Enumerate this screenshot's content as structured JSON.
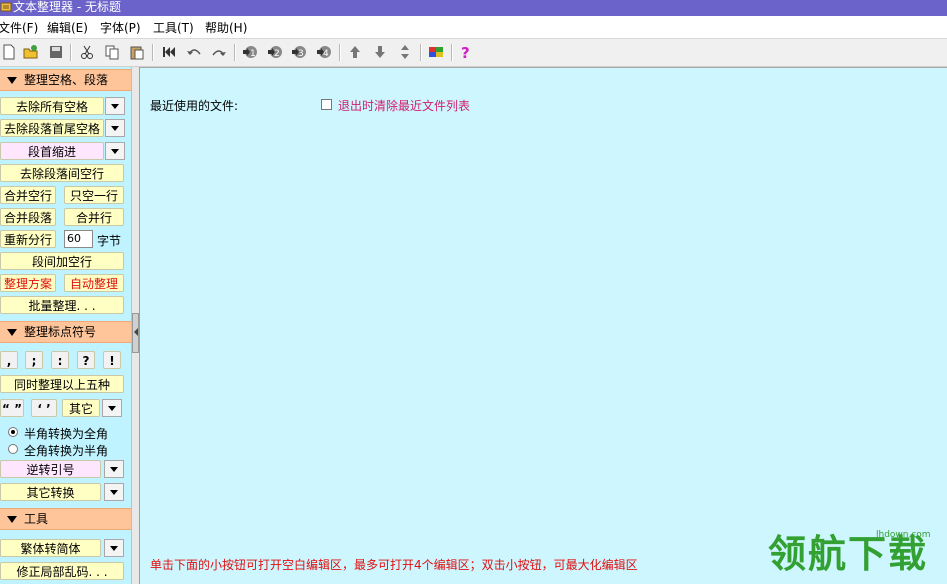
{
  "window": {
    "title": "文本整理器 - 无标题"
  },
  "menu": [
    "文件(F)",
    "编辑(E)",
    "字体(P)",
    "工具(T)",
    "帮助(H)"
  ],
  "colors": {
    "accent_title": "#6b63c9",
    "panel_bg": "#bff3ff",
    "main_bg": "#cef6ff",
    "section_bg": "#ffc59a",
    "hint_red": "#e01010",
    "watermark_green": "#33a032"
  },
  "toolbar_icons": [
    "new-file-icon",
    "open-file-icon",
    "save-icon",
    "cut-icon",
    "copy-icon",
    "paste-icon",
    "first-icon",
    "undo-icon",
    "redo-icon",
    "editor1-icon",
    "editor2-icon",
    "editor3-icon",
    "editor4-icon",
    "up-icon",
    "down-icon",
    "updown-icon",
    "palette-icon",
    "help-icon"
  ],
  "sections": {
    "s1": "整理空格、段落",
    "s2": "整理标点符号",
    "s3": "工具"
  },
  "buttons": {
    "remove_all_spaces": "去除所有空格",
    "remove_para_spaces": "去除段落首尾空格",
    "para_indent": "段首缩进",
    "remove_blank_lines": "去除段落间空行",
    "merge_blank": "合并空行",
    "single_blank": "只空一行",
    "merge_para": "合并段落",
    "merge_lines": "合并行",
    "rewrap": "重新分行",
    "rewrap_value": "60",
    "rewrap_unit": "字节",
    "add_blank": "段间加空行",
    "scheme": "整理方案",
    "auto": "自动整理",
    "batch": "批量整理. . .",
    "p_comma": ",",
    "p_semicolon": ";",
    "p_colon": ":",
    "p_question": "?",
    "p_exclaim": "!",
    "all_five": "同时整理以上五种",
    "dquote": "“ ”",
    "squote": "‘ ’",
    "other": "其它",
    "radio_half_to_full": "半角转换为全角",
    "radio_full_to_half": "全角转换为半角",
    "reverse_quote": "逆转引号",
    "other_convert": "其它转换",
    "trad_simp": "繁体转简体",
    "fix_garble": "修正局部乱码. . ."
  },
  "main": {
    "recent_label": "最近使用的文件:",
    "clear_on_exit": "退出时清除最近文件列表",
    "hint": "单击下面的小按钮可打开空白编辑区，最多可打开4个编辑区；双击小按钮，可最大化编辑区"
  },
  "watermark": {
    "big": "领航下载",
    "small": "lhdown.com"
  }
}
